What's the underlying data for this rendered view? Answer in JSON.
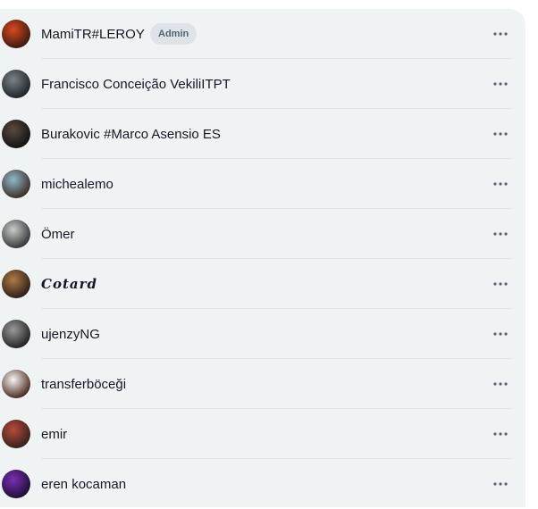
{
  "members": [
    {
      "name": "MamiTR#LEROY",
      "badge": "Admin",
      "avatar_colors": [
        "#d8481f",
        "#3a1a12"
      ],
      "avatar_icon": "avatar-icon"
    },
    {
      "name": "Francisco Conceição VekiliITPT",
      "badge": "",
      "avatar_colors": [
        "#7a8387",
        "#1e2428"
      ],
      "avatar_icon": "avatar-icon"
    },
    {
      "name": "Burakovic #Marco Asensio ES",
      "badge": "",
      "avatar_colors": [
        "#5a4a40",
        "#121212"
      ],
      "avatar_icon": "avatar-icon"
    },
    {
      "name": "michealemo",
      "badge": "",
      "avatar_colors": [
        "#8fb9c9",
        "#3c2d25"
      ],
      "avatar_icon": "avatar-icon"
    },
    {
      "name": "Ömer",
      "badge": "",
      "avatar_colors": [
        "#c9ccc7",
        "#33373a"
      ],
      "avatar_icon": "avatar-icon"
    },
    {
      "name": "Cotard",
      "badge": "",
      "avatar_colors": [
        "#b07a45",
        "#2c1f18"
      ],
      "avatar_icon": "avatar-icon",
      "style": "script"
    },
    {
      "name": "ujenzyNG",
      "badge": "",
      "avatar_colors": [
        "#9a9a9a",
        "#222222"
      ],
      "avatar_icon": "avatar-icon"
    },
    {
      "name": "transferböceği",
      "badge": "",
      "avatar_colors": [
        "#f6f6f6",
        "#4a2a1e"
      ],
      "avatar_icon": "avatar-icon"
    },
    {
      "name": "emir",
      "badge": "",
      "avatar_colors": [
        "#b84a3a",
        "#34221c"
      ],
      "avatar_icon": "avatar-icon"
    },
    {
      "name": "eren kocaman",
      "badge": "",
      "avatar_colors": [
        "#7b2fb5",
        "#1c0e33"
      ],
      "avatar_icon": "avatar-icon"
    }
  ],
  "more_icon": "more-horizontal-icon",
  "colors": {
    "panel_bg": "#f0f3f4",
    "text": "#141823",
    "divider": "#e1e6e9",
    "badge_bg": "#dde3e6",
    "badge_text": "#536471",
    "icon": "#536471"
  }
}
